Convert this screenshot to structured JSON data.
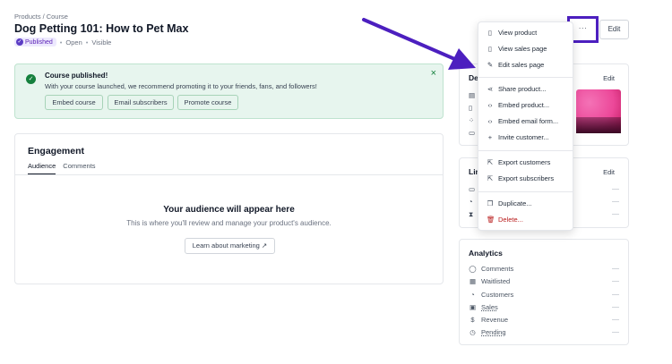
{
  "breadcrumb": {
    "parent": "Products",
    "separator": "/",
    "current": "Course"
  },
  "product": {
    "title": "Dog Petting 101: How to Pet Max",
    "status": "Published",
    "meta1": "Open",
    "meta2": "Visible"
  },
  "banner": {
    "title": "Course published!",
    "message": "With your course launched, we recommend promoting it to your friends, fans, and followers!",
    "actions": [
      "Embed course",
      "Email subscribers",
      "Promote course"
    ]
  },
  "engagement": {
    "title": "Engagement",
    "tabs": [
      "Audience",
      "Comments"
    ],
    "empty_title": "Your audience will appear here",
    "empty_message": "This is where you'll review and manage your product's audience.",
    "cta": "Learn about marketing"
  },
  "header_actions": {
    "more": "···",
    "edit": "Edit"
  },
  "menu": {
    "items": [
      {
        "label": "View product",
        "icon": "file-icon"
      },
      {
        "label": "View sales page",
        "icon": "file-icon"
      },
      {
        "label": "Edit sales page",
        "icon": "pencil-icon"
      },
      {
        "label": "Share product...",
        "icon": "share-icon"
      },
      {
        "label": "Embed product...",
        "icon": "code-icon"
      },
      {
        "label": "Embed email form...",
        "icon": "code-icon"
      },
      {
        "label": "Invite customer...",
        "icon": "plus-icon"
      },
      {
        "label": "Export customers",
        "icon": "export-icon"
      },
      {
        "label": "Export subscribers",
        "icon": "export-icon"
      },
      {
        "label": "Duplicate...",
        "icon": "copy-icon"
      },
      {
        "label": "Delete...",
        "icon": "trash-icon"
      }
    ]
  },
  "details_card": {
    "title": "De",
    "edit": "Edit"
  },
  "limits_card": {
    "title": "Lin",
    "edit": "Edit"
  },
  "analytics": {
    "title": "Analytics",
    "rows": [
      {
        "label": "Comments",
        "icon": "comment-icon"
      },
      {
        "label": "Waitlisted",
        "icon": "calendar-icon"
      },
      {
        "label": "Customers",
        "icon": "user-icon"
      },
      {
        "label": "Sales",
        "icon": "bag-icon"
      },
      {
        "label": "Revenue",
        "icon": "dollar-icon"
      },
      {
        "label": "Pending",
        "icon": "clock-icon"
      }
    ]
  },
  "colors": {
    "accent": "#4c1fbf",
    "success": "#15803d",
    "banner_bg": "#e7f5ee",
    "danger": "#b91c1c"
  }
}
